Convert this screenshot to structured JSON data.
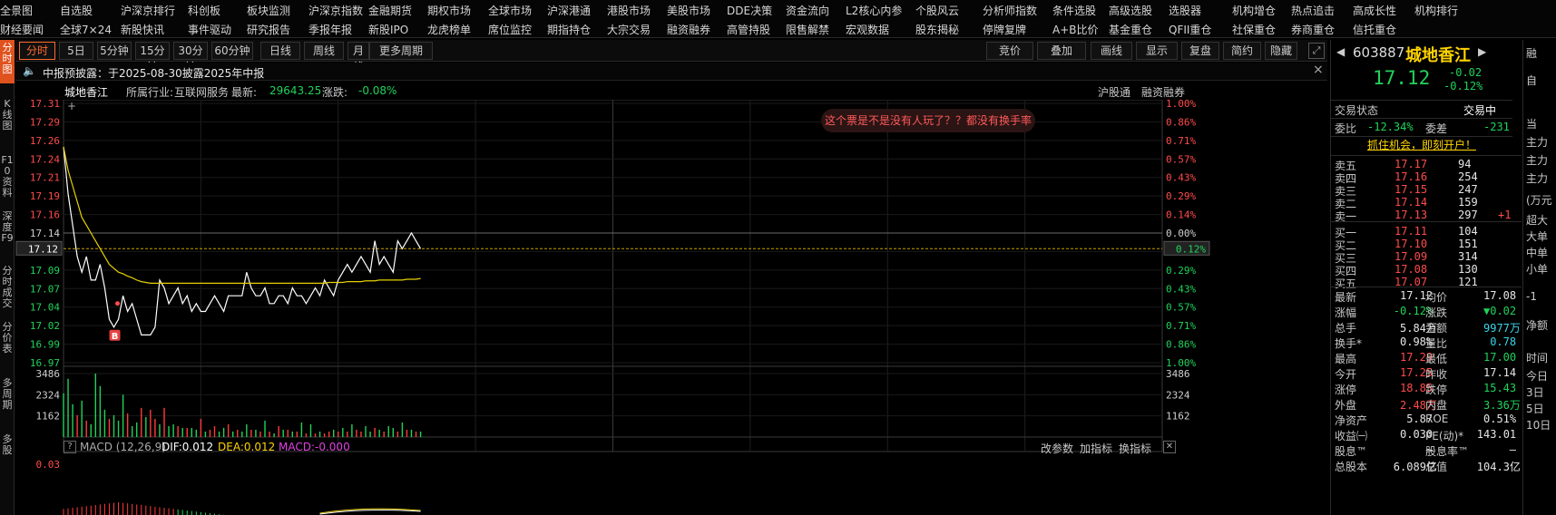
{
  "nav": {
    "row1": [
      "全景图",
      "自选股",
      "沪深京排行",
      "科创板",
      "板块监测",
      "沪深京指数",
      "金融期货",
      "期权市场",
      "全球市场",
      "沪深港通",
      "港股市场",
      "美股市场",
      "DDE决策",
      "资金流向",
      "L2核心内参",
      "个股风云",
      "分析师指数",
      "条件选股",
      "高级选股",
      "选股器",
      "机构增仓",
      "热点追击",
      "高成长性",
      "机构排行"
    ],
    "row2": [
      "财经要闻",
      "全球7×24",
      "新股快讯",
      "事件驱动",
      "研究报告",
      "季报年报",
      "新股IPO",
      "龙虎榜单",
      "席位监控",
      "期指持仓",
      "大宗交易",
      "融资融券",
      "高管持股",
      "限售解禁",
      "宏观数据",
      "股东揭秘",
      "停牌复牌",
      "A+B比价",
      "基金重仓",
      "QFII重仓",
      "社保重仓",
      "券商重仓",
      "信托重仓"
    ]
  },
  "sidebar": [
    "分时图",
    "K线图",
    "F10资料",
    "深度F9",
    "分时成交",
    "分价表",
    "多周期",
    "多股"
  ],
  "toolbar": {
    "left": [
      "分时",
      "5日",
      "5分钟",
      "15分钟",
      "30分钟",
      "60分钟",
      "日线",
      "周线",
      "月线",
      "更多周期"
    ],
    "right": [
      "竞价",
      "叠加",
      "画线",
      "显示",
      "复盘",
      "简约",
      "隐藏"
    ]
  },
  "notice": {
    "text": "中报预披露：于2025-08-30披露2025年中报",
    "close": "×"
  },
  "header": {
    "name": "城地香江",
    "industry_label": "所属行业:",
    "industry": "互联网服务",
    "latest_label": "最新:",
    "latest": "29643.25",
    "change_label": "涨跌:",
    "change": "-0.08%",
    "links": [
      "沪股通",
      "融资融券"
    ]
  },
  "price_axis": {
    "left": [
      "17.31",
      "17.29",
      "17.26",
      "17.24",
      "17.21",
      "17.19",
      "17.16",
      "17.14",
      "17.12",
      "17.09",
      "17.07",
      "17.04",
      "17.02",
      "16.99",
      "16.97"
    ],
    "right": [
      "1.00%",
      "0.86%",
      "0.71%",
      "0.57%",
      "0.43%",
      "0.29%",
      "0.14%",
      "0.00%",
      "0.12%",
      "0.29%",
      "0.43%",
      "0.57%",
      "0.71%",
      "0.86%",
      "1.00%"
    ],
    "current": "17.12",
    "current_pct": "0.12%"
  },
  "volume_axis": [
    "3486",
    "2324",
    "1162"
  ],
  "macd": {
    "help": "?",
    "label": "MACD (12,26,9)",
    "dif": "DIF:0.012",
    "dea": "DEA:0.012",
    "macd": "MACD:-0.000",
    "buttons": [
      "改参数",
      "加指标",
      "换指标"
    ],
    "axis": "0.03"
  },
  "comment": "这个票是不是没有人玩了？？都没有换手率",
  "trade_mark": "B",
  "chart_data": {
    "type": "line",
    "title": "",
    "xlabel": "",
    "ylabel": "",
    "ylim": [
      16.97,
      17.31
    ],
    "prev_close": 17.14,
    "series": [
      {
        "name": "price",
        "values": [
          17.25,
          17.19,
          17.15,
          17.11,
          17.09,
          17.11,
          17.08,
          17.08,
          17.1,
          17.07,
          17.03,
          17.02,
          17.03,
          17.06,
          17.04,
          17.05,
          17.03,
          17.01,
          17.01,
          17.01,
          17.02,
          17.08,
          17.07,
          17.05,
          17.06,
          17.07,
          17.05,
          17.06,
          17.04,
          17.05,
          17.04,
          17.04,
          17.05,
          17.06,
          17.05,
          17.04,
          17.06,
          17.06,
          17.06,
          17.06,
          17.09,
          17.07,
          17.06,
          17.06,
          17.07,
          17.05,
          17.05,
          17.06,
          17.06,
          17.05,
          17.07,
          17.06,
          17.06,
          17.05,
          17.06,
          17.07,
          17.06,
          17.08,
          17.07,
          17.06,
          17.08,
          17.09,
          17.1,
          17.09,
          17.1,
          17.11,
          17.1,
          17.09,
          17.13,
          17.1,
          17.11,
          17.1,
          17.09,
          17.13,
          17.12,
          17.13,
          17.14,
          17.13,
          17.12
        ]
      },
      {
        "name": "avg",
        "values": [
          17.25,
          17.22,
          17.2,
          17.18,
          17.16,
          17.15,
          17.14,
          17.13,
          17.12,
          17.11,
          17.1,
          17.095,
          17.09,
          17.088,
          17.085,
          17.083,
          17.08,
          17.078,
          17.077,
          17.076,
          17.076,
          17.076,
          17.076,
          17.076,
          17.076,
          17.076,
          17.076,
          17.076,
          17.076,
          17.076,
          17.076,
          17.076,
          17.076,
          17.076,
          17.076,
          17.076,
          17.076,
          17.076,
          17.076,
          17.076,
          17.076,
          17.076,
          17.076,
          17.076,
          17.076,
          17.076,
          17.076,
          17.076,
          17.076,
          17.076,
          17.076,
          17.076,
          17.076,
          17.076,
          17.076,
          17.076,
          17.076,
          17.076,
          17.077,
          17.077,
          17.077,
          17.077,
          17.078,
          17.078,
          17.078,
          17.078,
          17.079,
          17.079,
          17.079,
          17.08,
          17.08,
          17.08,
          17.08,
          17.08,
          17.08,
          17.081,
          17.081,
          17.081,
          17.082
        ]
      }
    ],
    "volume_ylim": [
      0,
      3486
    ],
    "volume": [
      2400,
      3200,
      1800,
      1200,
      2000,
      900,
      700,
      3486,
      2800,
      1500,
      1000,
      1200,
      900,
      2324,
      1300,
      600,
      800,
      1600,
      1100,
      1500,
      1000,
      700,
      1600,
      600,
      700,
      600,
      500,
      500,
      500,
      400,
      1000,
      300,
      400,
      600,
      300,
      500,
      700,
      300,
      400,
      300,
      700,
      400,
      400,
      300,
      900,
      300,
      200,
      600,
      400,
      400,
      300,
      300,
      800,
      200,
      700,
      200,
      300,
      200,
      300,
      400,
      300,
      500,
      300,
      700,
      400,
      300,
      600,
      300,
      500,
      400,
      300,
      600,
      500,
      300,
      800,
      400,
      400,
      300,
      300
    ],
    "volume_colors": [
      "g",
      "g",
      "g",
      "r",
      "g",
      "r",
      "g",
      "g",
      "g",
      "g",
      "r",
      "g",
      "g",
      "g",
      "r",
      "g",
      "g",
      "r",
      "g",
      "r",
      "r",
      "g",
      "r",
      "g",
      "g",
      "r",
      "g",
      "r",
      "g",
      "g",
      "r",
      "g",
      "r",
      "r",
      "g",
      "g",
      "r",
      "g",
      "r",
      "g",
      "g",
      "r",
      "g",
      "r",
      "g",
      "r",
      "g",
      "r",
      "g",
      "r",
      "g",
      "r",
      "g",
      "r",
      "g",
      "r",
      "g",
      "r",
      "r",
      "g",
      "r",
      "g",
      "r",
      "g",
      "r",
      "r",
      "g",
      "g",
      "r",
      "g",
      "r",
      "g",
      "g",
      "r",
      "g",
      "r",
      "g",
      "r",
      "g"
    ]
  },
  "stock": {
    "code": "603887",
    "name": "城地香江",
    "price": "17.12",
    "change": "-0.02",
    "change_pct": "-0.12%"
  },
  "panel": {
    "status_label": "交易状态",
    "status": "交易中",
    "weibi_label": "委比",
    "weibi": "-12.34%",
    "weicha_label": "委差",
    "weicha": "-231",
    "promo": "抓住机会，即刻开户！",
    "asks": [
      {
        "label": "卖五",
        "price": "17.17",
        "vol": "94",
        "extra": ""
      },
      {
        "label": "卖四",
        "price": "17.16",
        "vol": "254",
        "extra": ""
      },
      {
        "label": "卖三",
        "price": "17.15",
        "vol": "247",
        "extra": ""
      },
      {
        "label": "卖二",
        "price": "17.14",
        "vol": "159",
        "extra": ""
      },
      {
        "label": "卖一",
        "price": "17.13",
        "vol": "297",
        "extra": "+1"
      }
    ],
    "bids": [
      {
        "label": "买一",
        "price": "17.11",
        "vol": "104"
      },
      {
        "label": "买二",
        "price": "17.10",
        "vol": "151"
      },
      {
        "label": "买三",
        "price": "17.09",
        "vol": "314"
      },
      {
        "label": "买四",
        "price": "17.08",
        "vol": "130"
      },
      {
        "label": "买五",
        "price": "17.07",
        "vol": "121"
      }
    ],
    "stats": [
      [
        "最新",
        "17.12",
        "white",
        "均价",
        "17.08",
        "white"
      ],
      [
        "涨幅",
        "-0.12%",
        "green",
        "涨跌",
        "▼0.02",
        "green"
      ],
      [
        "总手",
        "5.84万",
        "white",
        "金额",
        "9977万",
        "cyan"
      ],
      [
        "换手*",
        "0.98%",
        "white",
        "量比",
        "0.78",
        "cyan"
      ],
      [
        "最高",
        "17.29",
        "red",
        "最低",
        "17.00",
        "green"
      ],
      [
        "今开",
        "17.25",
        "red",
        "昨收",
        "17.14",
        "white"
      ],
      [
        "涨停",
        "18.85",
        "red",
        "跌停",
        "15.43",
        "green"
      ],
      [
        "外盘",
        "2.48万",
        "red",
        "内盘",
        "3.36万",
        "green"
      ],
      [
        "净资产",
        "5.87",
        "white",
        "ROE",
        "0.51%",
        "white"
      ],
      [
        "收益㈠",
        "0.030",
        "white",
        "PE(动)*",
        "143.01",
        "white"
      ],
      [
        "股息™",
        "—",
        "white",
        "股息率™",
        "—",
        "white"
      ],
      [
        "总股本",
        "6.089亿",
        "white",
        "总值",
        "104.3亿",
        "white"
      ]
    ],
    "far_right": [
      "融",
      "自",
      "当",
      "主力",
      "主力",
      "主力",
      "(万元",
      "超大",
      "大单",
      "中单",
      "小单",
      "-1",
      "净额",
      "时间",
      "今日",
      "3日",
      "5日",
      "10日"
    ]
  }
}
